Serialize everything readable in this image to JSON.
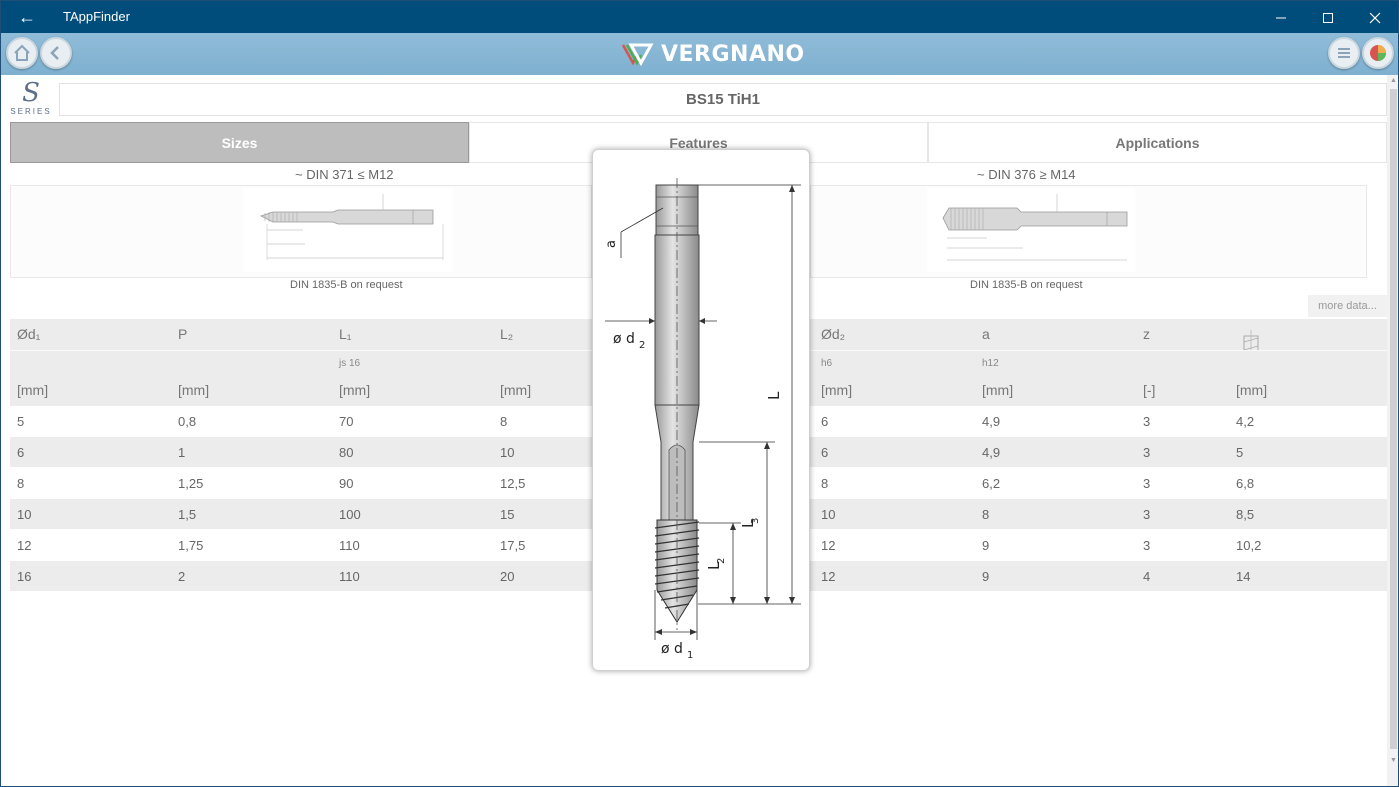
{
  "window": {
    "title": "TAppFinder",
    "back_glyph": "←",
    "minimize_glyph": "—",
    "maximize_glyph": "☐",
    "close_glyph": "✕"
  },
  "appbar": {
    "brand": "VERGNANO"
  },
  "series": {
    "letter": "S",
    "word": "SERIES"
  },
  "product": {
    "name": "BS15 TiH1"
  },
  "tabs": [
    {
      "label": "Sizes",
      "active": true
    },
    {
      "label": "Features",
      "active": false
    },
    {
      "label": "Applications",
      "active": false
    }
  ],
  "standards": [
    {
      "label": "~  DIN 371 ≤ M12",
      "caption": "DIN 1835-B on request"
    },
    {
      "label": "~  DIN 376 ≥ M14",
      "caption": "DIN 1835-B on request"
    }
  ],
  "more_data_label": "more data...",
  "table": {
    "headers": [
      "Ød₁",
      "P",
      "L₁",
      "L₂",
      "",
      "Ød₂",
      "a",
      "z",
      ""
    ],
    "tolerances": [
      "",
      "",
      "js 16",
      "",
      "",
      "h6",
      "h12",
      "",
      ""
    ],
    "units": [
      "[mm]",
      "[mm]",
      "[mm]",
      "[mm]",
      "",
      "[mm]",
      "[mm]",
      "[-]",
      "[mm]"
    ],
    "rows": [
      [
        "5",
        "0,8",
        "70",
        "8",
        "",
        "6",
        "4,9",
        "3",
        "4,2"
      ],
      [
        "6",
        "1",
        "80",
        "10",
        "",
        "6",
        "4,9",
        "3",
        "5"
      ],
      [
        "8",
        "1,25",
        "90",
        "12,5",
        "",
        "8",
        "6,2",
        "3",
        "6,8"
      ],
      [
        "10",
        "1,5",
        "100",
        "15",
        "",
        "10",
        "8",
        "3",
        "8,5"
      ],
      [
        "12",
        "1,75",
        "110",
        "17,5",
        "",
        "12",
        "9",
        "3",
        "10,2"
      ],
      [
        "16",
        "2",
        "110",
        "20",
        "",
        "12",
        "9",
        "4",
        "14"
      ]
    ]
  },
  "drawing_labels": {
    "a": "a",
    "d2": "ø d",
    "d2_sub": "2",
    "d1": "ø d",
    "d1_sub": "1",
    "L1": "L",
    "L2": "L",
    "L2_sub": "2",
    "L3": "L",
    "L3_sub": "3"
  },
  "colors": {
    "titlebar": "#004c7a",
    "appbar": "#88b7d5",
    "tab_active": "#bdbdbd",
    "row_alt": "#ececec"
  }
}
